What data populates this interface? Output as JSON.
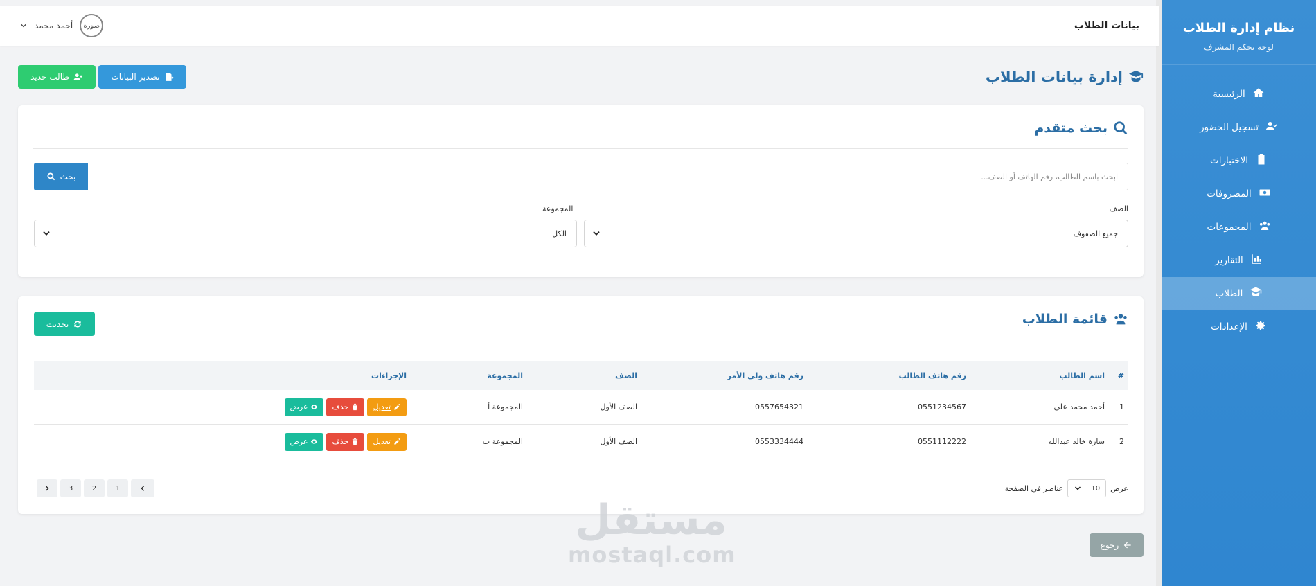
{
  "sidebar": {
    "brand_title": "نظام إدارة الطلاب",
    "brand_subtitle": "لوحة تحكم المشرف",
    "items": [
      {
        "label": "الرئيسية",
        "icon": "home-icon"
      },
      {
        "label": "تسجيل الحضور",
        "icon": "user-check-icon"
      },
      {
        "label": "الاختبارات",
        "icon": "clipboard-icon"
      },
      {
        "label": "المصروفات",
        "icon": "money-icon"
      },
      {
        "label": "المجموعات",
        "icon": "users-icon"
      },
      {
        "label": "التقارير",
        "icon": "chart-icon"
      },
      {
        "label": "الطلاب",
        "icon": "graduate-icon",
        "active": true
      },
      {
        "label": "الإعدادات",
        "icon": "gear-icon"
      }
    ]
  },
  "topbar": {
    "title": "بيانات الطلاب",
    "user_name": "أحمد محمد",
    "avatar_alt": "صورة"
  },
  "page": {
    "title": "إدارة بيانات الطلاب",
    "new_student": "طالب جديد",
    "export": "تصدير البيانات"
  },
  "search": {
    "title": "بحث متقدم",
    "placeholder": "ابحث باسم الطالب، رقم الهاتف أو الصف...",
    "button": "بحث",
    "class_label": "الصف",
    "class_value": "جميع الصفوف",
    "group_label": "المجموعة",
    "group_value": "الكل"
  },
  "list": {
    "title": "قائمة الطلاب",
    "refresh": "تحديث",
    "columns": [
      "#",
      "اسم الطالب",
      "رقم هاتف الطالب",
      "رقم هاتف ولي الأمر",
      "الصف",
      "المجموعة",
      "الإجراءات"
    ],
    "rows": [
      {
        "num": "1",
        "name": "أحمد محمد علي",
        "phone": "0551234567",
        "parent_phone": "0557654321",
        "class": "الصف الأول",
        "group": "المجموعة أ"
      },
      {
        "num": "2",
        "name": "سارة خالد عبدالله",
        "phone": "0551112222",
        "parent_phone": "0553334444",
        "class": "الصف الأول",
        "group": "المجموعة ب"
      }
    ],
    "actions": {
      "edit": "تعديل",
      "delete": "حذف",
      "view": "عرض"
    },
    "per_page_prefix": "عرض",
    "per_page_value": "10",
    "per_page_suffix": "عناصر في الصفحة",
    "pages": [
      "1",
      "2",
      "3"
    ]
  },
  "back": "رجوع",
  "watermark": {
    "ar": "مستقل",
    "en": "mostaql.com"
  },
  "colors": {
    "sidebar": "#3b8fd4",
    "primary": "#2c6ea5",
    "green": "#2ecc71",
    "blue": "#3498db",
    "teal": "#1abc9c",
    "orange": "#f39c12",
    "red": "#e74c3c",
    "gray": "#95a5a6"
  }
}
